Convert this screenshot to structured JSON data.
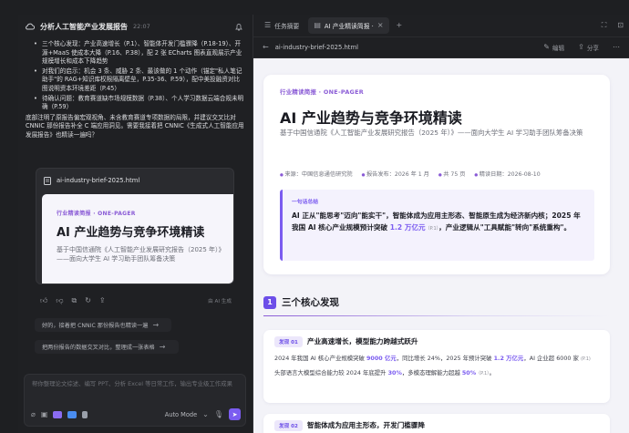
{
  "left": {
    "title": "分析人工智能产业发展报告",
    "time": "22:07",
    "bullets": [
      "三个核心发现：产业高速增长（P.1）、智能体开发门槛骤降（P.18-19）、开源+MaaS 使成本大降（P.16、P.38），配 2 张 ECharts 图表直观展示产业规模增长和成本下降趋势",
      "对我们的启示：机会 3 条、威胁 2 条、最该做的 1 个动作（锚定\"私人笔记助手\"的 RAG+知识库权限隔离壁垒，P.35-36、P.59），配中美投融资对比图说明资本环境差距（P.45）",
      "待确认问题：教育赛道缺市场规模数据（P.38）、个人学习数据云端合规未明确（P.59）"
    ],
    "closing": "底部注明了原报告偏宏观视角、未含教育赛道专项数据的局限，并建议交叉比对 CNNIC 那份报告补全 C 端应用洞见。需要我接着把 CNNIC《生成式人工智能应用发展报告》也精读一遍吗？",
    "card": {
      "filename": "ai-industry-brief-2025.html",
      "tag": "行业精读简报 · ONE-PAGER",
      "title": "AI 产业趋势与竞争环境精读",
      "subtitle": "基于中国信通院《人工智能产业发展研究报告（2025 年）》——面向大学生 AI 学习助手团队筹备决策"
    },
    "ai_label": "由 AI 生成",
    "suggestions": [
      "好的，接着把 CNNIC 那份报告也精读一遍",
      "把两份报告的数据交叉对比，整理成一张表格"
    ],
    "input": {
      "placeholder": "帮你整理论文综述、编写 PPT、分析 Excel 等日常工作，输出专业级工作成果",
      "mode": "Auto Mode"
    }
  },
  "right": {
    "tabs": [
      "任务摘要",
      "AI 产业精读简报 ·"
    ],
    "address": "ai-industry-brief-2025.html",
    "edit_label": "编辑",
    "share_label": "分享",
    "doc": {
      "tag": "行业精读简报 · ONE-PAGER",
      "title": "AI 产业趋势与竞争环境精读",
      "subtitle": "基于中国信通院《人工智能产业发展研究报告（2025 年）》——面向大学生 AI 学习助手团队筹备决策",
      "meta": [
        "来源：中国信息通信研究院",
        "报告发布：2026 年 1 月",
        "共 75 页",
        "精读日期：2026-08-10"
      ],
      "summary_title": "一句话总结",
      "summary_a": "AI 正从\"能思考\"迈向\"能实干\"，智能体成为应用主形态、智能原生成为经济新内核；2025 年我国 AI 核心产业规模预计突破 ",
      "summary_hl": "1.2 万亿元",
      "summary_ref": "（P.1）",
      "summary_b": "，产业逻辑从\"工具赋能\"转向\"系统重构\"。",
      "section_num": "1",
      "section_title": "三个核心发现",
      "finding1": {
        "badge": "发现 01",
        "title": "产业高速增长，模型能力跨越式跃升",
        "p1_a": "2024 年我国 AI 核心产业规模突破 ",
        "p1_h1": "9000 亿元",
        "p1_b": "，同比增长 24%，2025 年预计突破 ",
        "p1_h2": "1.2 万亿元",
        "p1_c": "，AI 企业超 6000 家 ",
        "p1_ref": "(P.1)",
        "p2_a": "头部语言大模型综合能力较 2024 年底提升 ",
        "p2_h1": "30%",
        "p2_b": "，多模态理解能力超越 ",
        "p2_h2": "50%",
        "p2_ref": "（P.1）",
        "p2_c": "。"
      },
      "finding2": {
        "badge": "发现 02",
        "title": "智能体成为应用主形态，开发门槛骤降"
      }
    }
  }
}
